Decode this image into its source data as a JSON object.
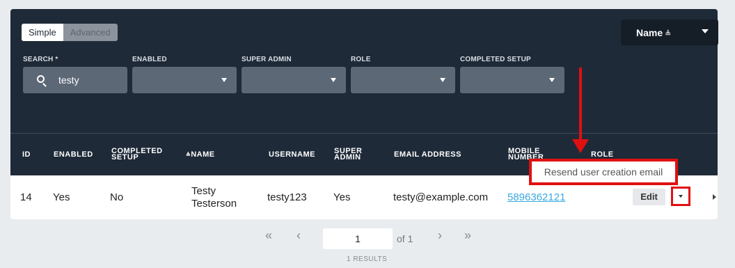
{
  "mode_toggle": {
    "simple": "Simple",
    "advanced": "Advanced"
  },
  "sort": {
    "label": "Name",
    "icon": "sort-asc-icon"
  },
  "filters": {
    "search_label": "SEARCH *",
    "search_value": "testy",
    "enabled_label": "ENABLED",
    "super_admin_label": "SUPER ADMIN",
    "role_label": "ROLE",
    "completed_setup_label": "COMPLETED SETUP"
  },
  "table": {
    "headers": {
      "id": "ID",
      "enabled": "ENABLED",
      "completed_1": "COMPLETED",
      "completed_2": "SETUP",
      "name": "NAME",
      "username": "USERNAME",
      "super_1": "SUPER",
      "super_2": "ADMIN",
      "email": "EMAIL ADDRESS",
      "mobile_1": "MOBILE",
      "mobile_2": "NUMBER",
      "role": "ROLE"
    },
    "rows": [
      {
        "id": "14",
        "enabled": "Yes",
        "completed": "No",
        "name_1": "Testy",
        "name_2": "Testerson",
        "username": "testy123",
        "super_admin": "Yes",
        "email": "testy@example.com",
        "mobile": "5896362121",
        "edit_label": "Edit"
      }
    ]
  },
  "dropdown_tooltip": "Resend user creation email",
  "pagination": {
    "first": "«",
    "prev": "‹",
    "page": "1",
    "of": "of 1",
    "next": "›",
    "last": "»",
    "results": "1 RESULTS"
  },
  "colors": {
    "panel": "#1f2a38",
    "highlight": "#e01010",
    "link": "#39a9e0"
  }
}
